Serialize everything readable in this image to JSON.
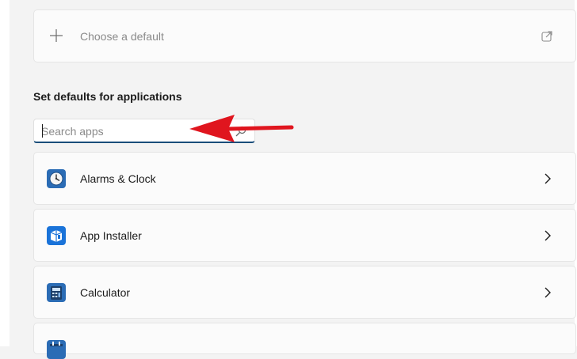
{
  "default_picker": {
    "label": "Choose a default",
    "add_icon": "plus-icon",
    "link_icon": "external-link-icon"
  },
  "section": {
    "title": "Set defaults for applications"
  },
  "search": {
    "placeholder": "Search apps",
    "value": "",
    "icon": "search-icon"
  },
  "apps": [
    {
      "label": "Alarms & Clock",
      "icon": "alarms-clock-icon"
    },
    {
      "label": "App Installer",
      "icon": "app-installer-icon"
    },
    {
      "label": "Calculator",
      "icon": "calculator-icon"
    },
    {
      "label": "",
      "icon": "calendar-icon"
    }
  ],
  "annotation": {
    "type": "red-arrow",
    "color": "#e0151e",
    "points_to": "search-input"
  }
}
